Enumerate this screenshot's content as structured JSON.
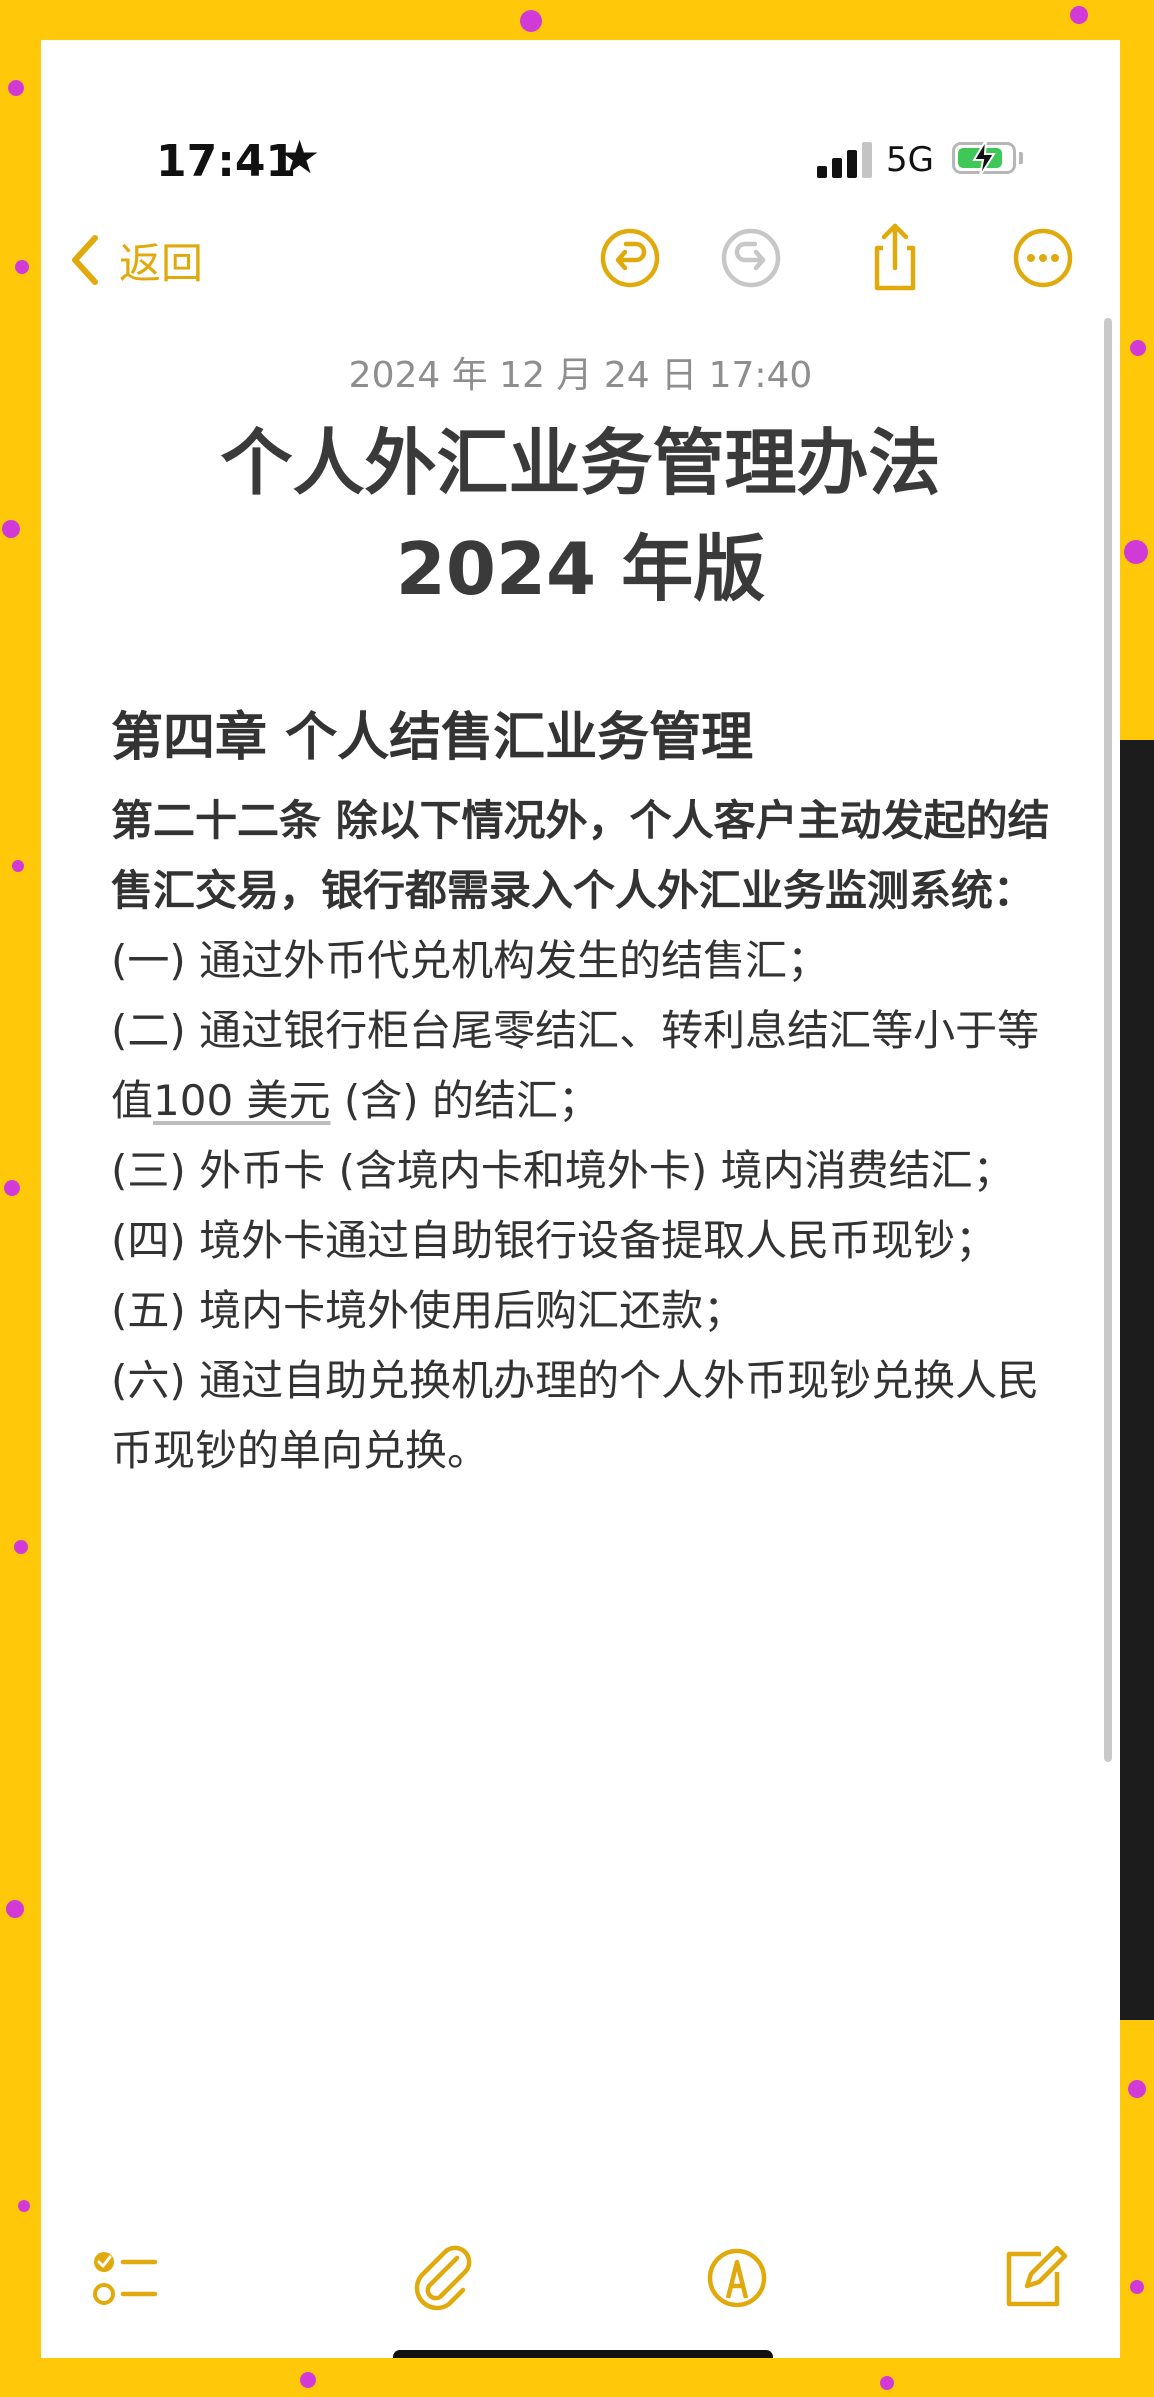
{
  "status_bar": {
    "time": "17:41",
    "network": "5G",
    "battery_level": 0.85
  },
  "toolbar": {
    "back_label": "返回",
    "icons": [
      "undo-icon",
      "redo-icon",
      "share-icon",
      "more-icon"
    ]
  },
  "note": {
    "date": "2024 年 12 月 24 日 17:40",
    "title_line1": "个人外汇业务管理办法",
    "title_line2": "2024 年版",
    "chapter": "第四章 个人结售汇业务管理",
    "article": "第二十二条 除以下情况外，个人客户主动发起的结售汇交易，银行都需录入个人外汇业务监测系统：",
    "items": [
      {
        "text": "(一) 通过外币代兑机构发生的结售汇；"
      },
      {
        "pre": "(二) 通过银行柜台尾零结汇、转利息结汇等小于等值",
        "underlined": "100 美元",
        "post": " (含) 的结汇；"
      },
      {
        "text": "(三) 外币卡 (含境内卡和境外卡) 境内消费结汇；"
      },
      {
        "text": "(四) 境外卡通过自助银行设备提取人民币现钞；"
      },
      {
        "text": "(五) 境内卡境外使用后购汇还款；"
      },
      {
        "text": "(六) 通过自助兑换机办理的个人外币现钞兑换人民币现钞的单向兑换。"
      }
    ]
  },
  "bottom_toolbar": {
    "icons": [
      "checklist-icon",
      "attachment-icon",
      "markup-icon",
      "compose-icon"
    ]
  },
  "colors": {
    "accent": "#e0aa0c",
    "background": "#ffc90a",
    "dots": "#d23ad8"
  }
}
